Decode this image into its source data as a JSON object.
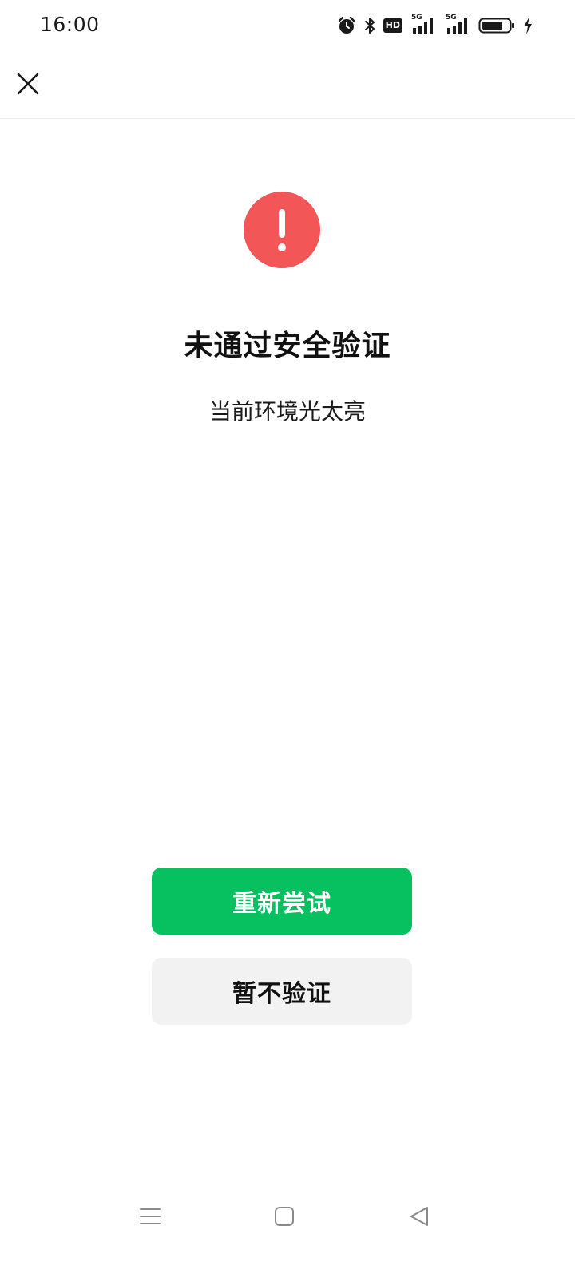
{
  "status_bar": {
    "time": "16:00",
    "icons": [
      "alarm-icon",
      "bluetooth-icon",
      "hd-icon",
      "signal-5g-icon",
      "signal-5g-icon",
      "battery-icon",
      "charging-icon"
    ],
    "hd_label": "HD",
    "network_label_1": "5G",
    "network_label_2": "5G"
  },
  "nav": {
    "close_icon": "close-icon"
  },
  "result": {
    "icon": "exclamation-icon",
    "icon_color": "#f25656",
    "title": "未通过安全验证",
    "description": "当前环境光太亮"
  },
  "actions": {
    "retry_label": "重新尝试",
    "retry_color": "#07c160",
    "skip_label": "暂不验证",
    "skip_color": "#f2f2f2"
  },
  "system_nav": {
    "menu_icon": "menu-icon",
    "home_icon": "home-icon",
    "back_icon": "back-icon"
  }
}
